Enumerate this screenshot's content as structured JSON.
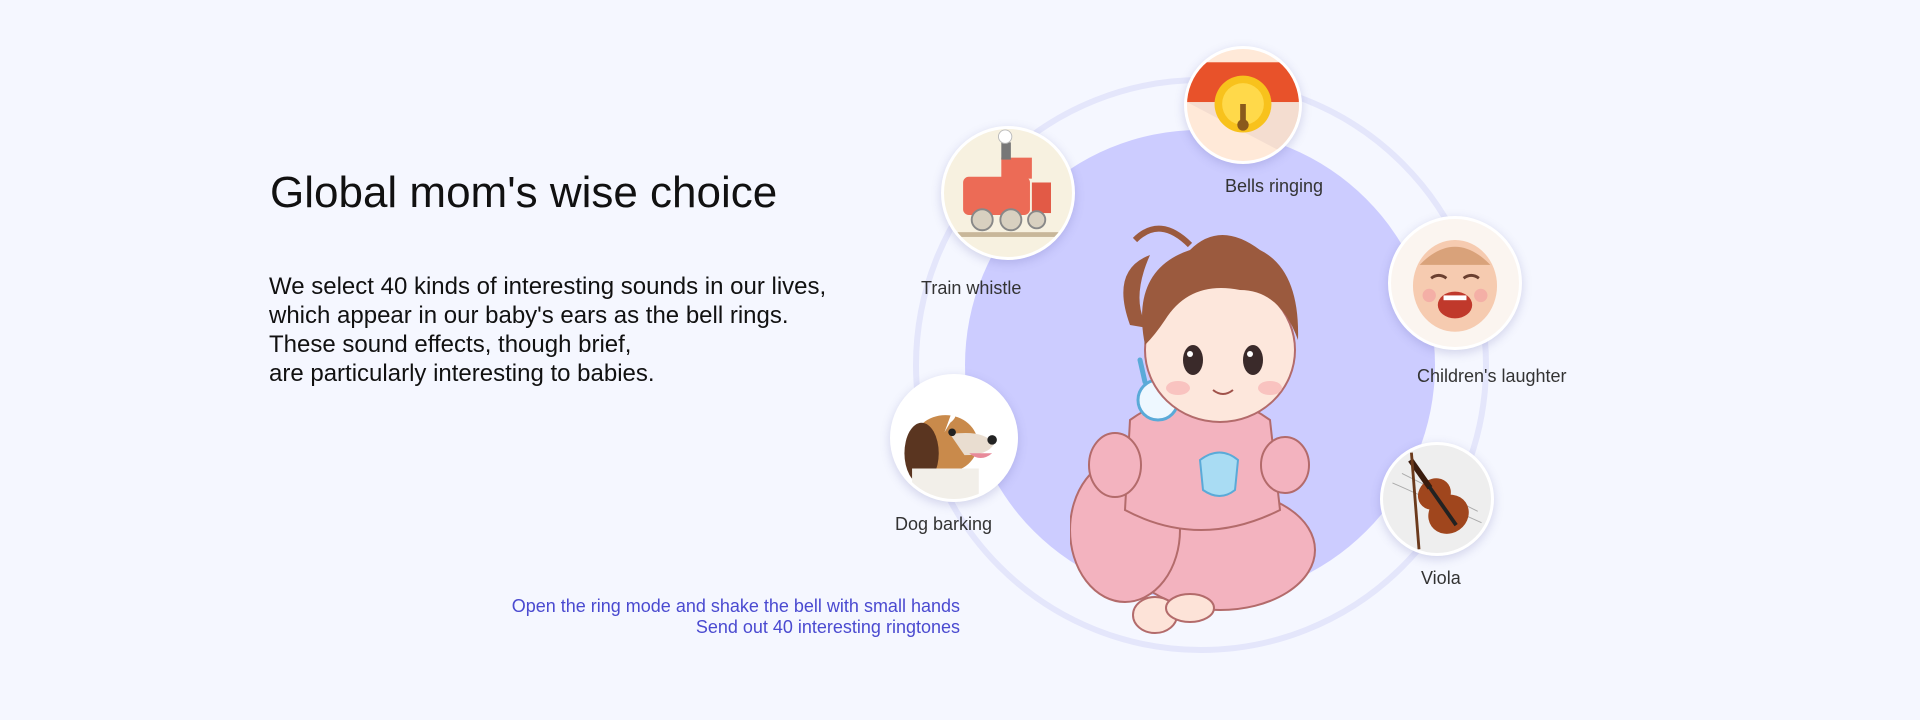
{
  "headline": "Global mom's wise choice",
  "intro_lines": [
    "We select 40 kinds of interesting sounds in our lives,",
    "which appear in our baby's ears as the bell rings.",
    "These sound effects, though brief,",
    "are particularly interesting to babies."
  ],
  "note_lines": [
    "Open the ring mode and shake the bell with small hands",
    "Send out 40 interesting ringtones"
  ],
  "sounds": [
    {
      "label": "Bells ringing",
      "icon": "bell-icon"
    },
    {
      "label": "Train whistle",
      "icon": "train-icon"
    },
    {
      "label": "Children's laughter",
      "icon": "laughing-child-icon"
    },
    {
      "label": "Dog barking",
      "icon": "dog-icon"
    },
    {
      "label": "Viola",
      "icon": "viola-icon"
    }
  ],
  "colors": {
    "background": "#f5f7ff",
    "disc": "#ccccff",
    "ring": "#e4e6fb",
    "note_text": "#4a4ad0"
  }
}
